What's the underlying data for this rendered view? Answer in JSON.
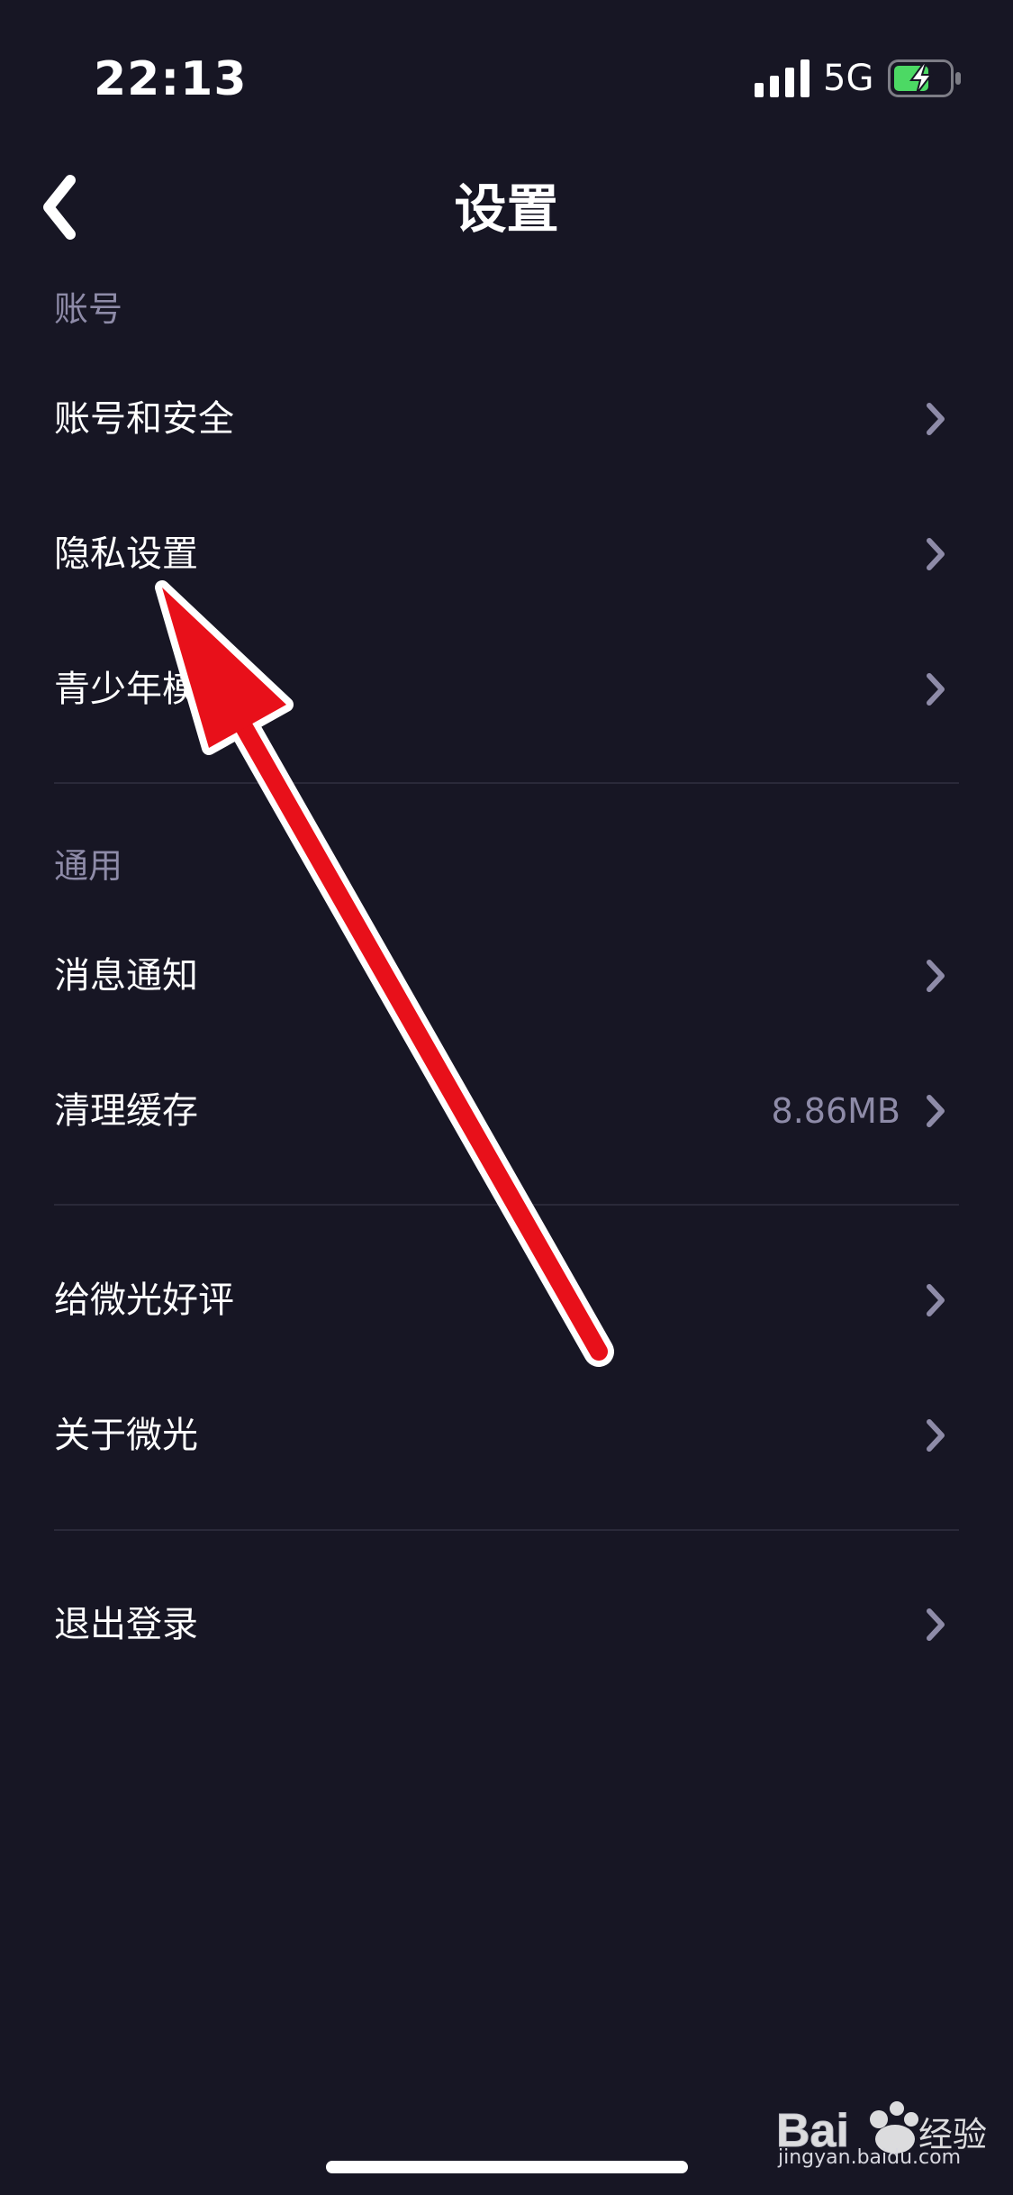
{
  "status_bar": {
    "time": "22:13",
    "network": "5G",
    "signal_icon": "signal-bars-icon",
    "battery_icon": "battery-charging-icon",
    "battery_color": "#4cd964"
  },
  "nav": {
    "back_icon": "chevron-left-icon",
    "title": "设置"
  },
  "sections": {
    "account": {
      "header": "账号",
      "items": [
        {
          "label": "账号和安全"
        },
        {
          "label": "隐私设置"
        },
        {
          "label": "青少年模式"
        }
      ]
    },
    "general": {
      "header": "通用",
      "items": [
        {
          "label": "消息通知"
        },
        {
          "label": "清理缓存",
          "value": "8.86MB"
        }
      ]
    },
    "about": {
      "items": [
        {
          "label": "给微光好评"
        },
        {
          "label": "关于微光"
        }
      ]
    },
    "logout": {
      "items": [
        {
          "label": "退出登录"
        }
      ]
    }
  },
  "annotation": {
    "arrow_color": "#e8101a",
    "arrow_outline": "#ffffff"
  },
  "watermark": {
    "brand": "Bai",
    "brand_suffix": "经验",
    "url": "jingyan.baidu.com"
  },
  "colors": {
    "background": "#171624",
    "secondary_text": "#8e8ba8",
    "chevron": "#8e8ba8"
  }
}
